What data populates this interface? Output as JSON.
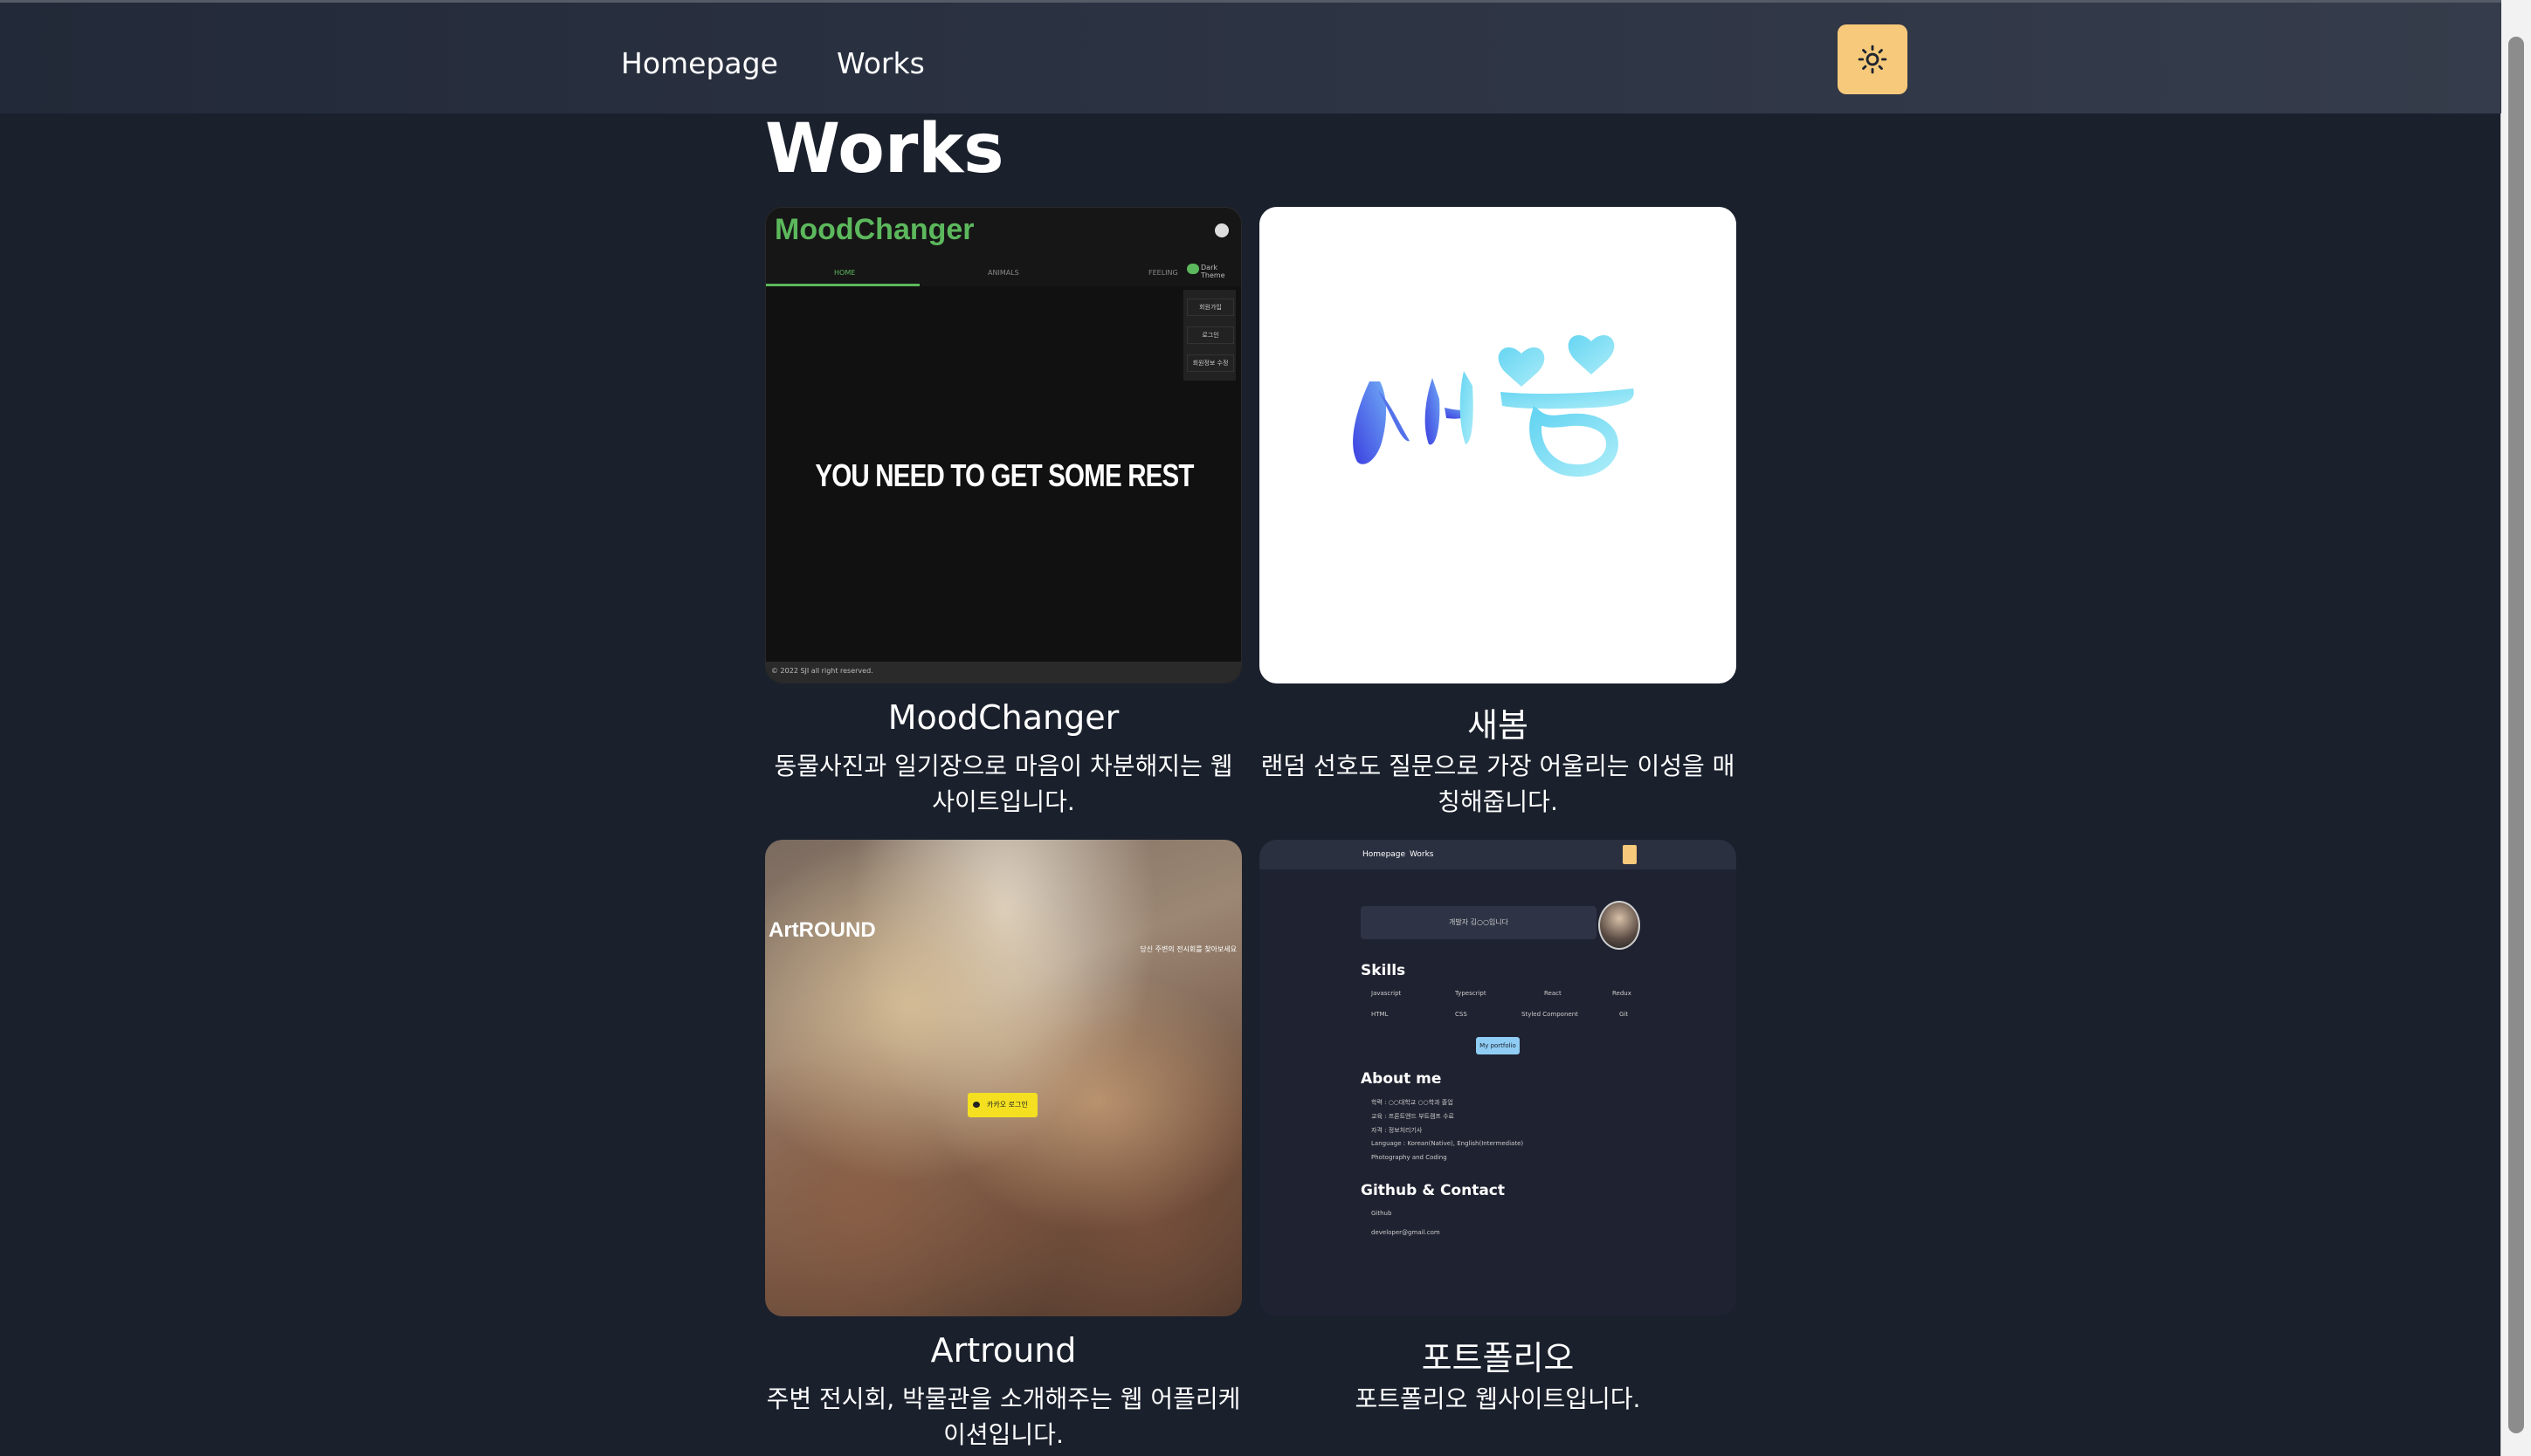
{
  "nav": {
    "homepage_label": "Homepage",
    "works_label": "Works",
    "theme_icon": "sun-icon",
    "theme_button_color": "#f6c97b"
  },
  "page": {
    "title": "Works"
  },
  "works": [
    {
      "title": "MoodChanger",
      "description": "동물사진과 일기장으로 마음이 차분해지는 웹사이트입니다.",
      "thumb": {
        "brand": "MoodChanger",
        "tabs": [
          "HOME",
          "ANIMALS",
          "FEELING"
        ],
        "toggle_label": "Dark Theme",
        "side_buttons": [
          "회원가입",
          "로그인",
          "회원정보 수정"
        ],
        "headline": "YOU NEED TO GET SOME REST",
        "footer": "© 2022 SJI all right reserved."
      }
    },
    {
      "title": "새봄",
      "description": "랜덤 선호도 질문으로 가장 어울리는 이성을 매칭해줍니다.",
      "thumb": {
        "logo_text": "새봄"
      }
    },
    {
      "title": "Artround",
      "description": "주변 전시회, 박물관을 소개해주는 웹 어플리케이션입니다.",
      "thumb": {
        "brand": "ArtROUND",
        "tagline": "당신 주변의 전시회를 찾아보세요",
        "login_label": "카카오 로그인"
      }
    },
    {
      "title": "포트폴리오",
      "description": "포트폴리오 웹사이트입니다.",
      "thumb": {
        "nav_items": [
          "Homepage",
          "Works"
        ],
        "search_text": "개발자 김○○입니다",
        "skills_heading": "Skills",
        "skills": [
          "Javascript",
          "Typescript",
          "React",
          "Redux",
          "HTML",
          "CSS",
          "Styled Component",
          "Git"
        ],
        "portfolio_button": "My portfolio",
        "about_heading": "About me",
        "about_lines": [
          "학력 : ○○대학교 ○○학과 졸업",
          "교육 : 프론트엔드 부트캠프 수료",
          "자격 : 정보처리기사",
          "Language : Korean(Native), English(Intermediate)",
          "Photography and Coding"
        ],
        "contact_heading": "Github & Contact",
        "github_label": "Github",
        "email": "developer@gmail.com"
      }
    }
  ]
}
